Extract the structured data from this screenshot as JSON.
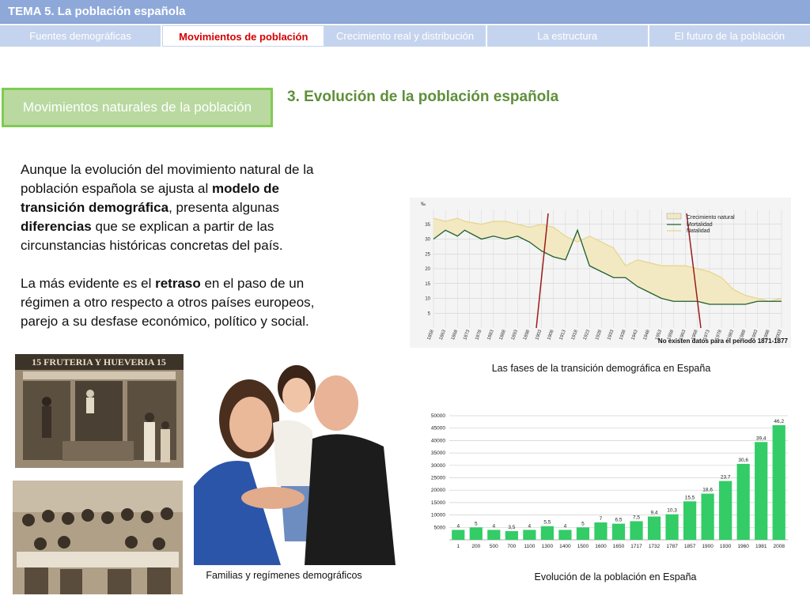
{
  "header": {
    "title": "TEMA 5. La población española"
  },
  "tabs": [
    {
      "label": "Fuentes demográficas",
      "active": false
    },
    {
      "label": "Movimientos de población",
      "active": true
    },
    {
      "label": "Crecimiento real y distribución",
      "active": false
    },
    {
      "label": "La estructura",
      "active": false
    },
    {
      "label": "El futuro de la población",
      "active": false
    }
  ],
  "section_button": {
    "label": "Movimientos naturales de la población"
  },
  "heading": "3. Evolución de la población española",
  "paragraph1": {
    "t1": "Aunque la evolución del movimiento natural de la población española se ajusta al ",
    "b1": "modelo de transición demográfica",
    "t2": ", presenta algunas ",
    "b2": "diferencias",
    "t3": " que se explican a partir de las circunstancias históricas concretas del país."
  },
  "paragraph2": {
    "t1": "La más evidente es el ",
    "b1": "retraso",
    "t2": "  en el paso de un régimen a otro respecto a otros países europeos, parejo a su desfase económico, político y social."
  },
  "photos": {
    "shop_sign": "15 FRUTERIA Y HUEVERIA 15"
  },
  "captions": {
    "family": "Familias y regímenes demográficos",
    "transition": "Las fases de la transición demográfica en España",
    "population": "Evolución de la población en España"
  },
  "chart_data": [
    {
      "type": "line",
      "legend": [
        "Crecimiento natural",
        "Mortalidad",
        "Natalidad"
      ],
      "ylabel": "‰",
      "y_ticks": [
        5,
        10,
        15,
        20,
        25,
        30,
        35
      ],
      "x_ticks": [
        "1858",
        "1863",
        "1868",
        "1873",
        "1878",
        "1883",
        "1888",
        "1893",
        "1898",
        "1903",
        "1908",
        "1913",
        "1918",
        "1923",
        "1928",
        "1933",
        "1938",
        "1943",
        "1948",
        "1953",
        "1958",
        "1963",
        "1968",
        "1973",
        "1978",
        "1983",
        "1988",
        "1993",
        "1998",
        "2003"
      ],
      "note": "No existen datos para el período 1871-1877",
      "series": [
        {
          "name": "Natalidad",
          "x": [
            1858,
            1863,
            1868,
            1871,
            1878,
            1883,
            1888,
            1893,
            1898,
            1903,
            1908,
            1913,
            1918,
            1923,
            1928,
            1933,
            1938,
            1943,
            1948,
            1953,
            1958,
            1963,
            1968,
            1973,
            1978,
            1983,
            1988,
            1993,
            1998,
            2003
          ],
          "values": [
            37,
            36,
            37,
            36,
            35,
            36,
            36,
            35,
            34,
            35,
            34,
            31,
            29,
            31,
            29,
            27,
            21,
            23,
            22,
            21,
            21,
            21,
            20,
            19,
            17,
            13,
            11,
            10,
            9,
            10
          ]
        },
        {
          "name": "Mortalidad",
          "x": [
            1858,
            1863,
            1868,
            1871,
            1878,
            1883,
            1888,
            1893,
            1898,
            1903,
            1908,
            1913,
            1918,
            1923,
            1928,
            1933,
            1938,
            1943,
            1948,
            1953,
            1958,
            1963,
            1968,
            1973,
            1978,
            1983,
            1988,
            1993,
            1998,
            2003
          ],
          "values": [
            30,
            33,
            31,
            33,
            30,
            31,
            30,
            31,
            29,
            26,
            24,
            23,
            33,
            21,
            19,
            17,
            17,
            14,
            12,
            10,
            9,
            9,
            9,
            8,
            8,
            8,
            8,
            9,
            9,
            9
          ]
        }
      ]
    },
    {
      "type": "bar",
      "categories": [
        "1",
        "200",
        "500",
        "700",
        "1100",
        "1300",
        "1400",
        "1500",
        "1600",
        "1650",
        "1717",
        "1732",
        "1787",
        "1857",
        "1900",
        "1930",
        "1960",
        "1981",
        "2008"
      ],
      "values": [
        4,
        5,
        4,
        3.5,
        4,
        5.5,
        4,
        5,
        7,
        6.5,
        7.5,
        9.4,
        10.3,
        15.5,
        18.6,
        23.7,
        30.6,
        39.4,
        46.2
      ],
      "labels": [
        "4",
        "5",
        "4",
        "3,5",
        "4",
        "5,5",
        "4",
        "5",
        "7",
        "6,5",
        "7,5",
        "9,4",
        "10,3",
        "15,5",
        "18,6",
        "23,7",
        "30,6",
        "39,4",
        "46,2"
      ],
      "y_ticks": [
        5000,
        10000,
        15000,
        20000,
        25000,
        30000,
        35000,
        40000,
        45000,
        50000
      ],
      "ylim": [
        0,
        50000
      ],
      "color": "#33CC66"
    }
  ]
}
